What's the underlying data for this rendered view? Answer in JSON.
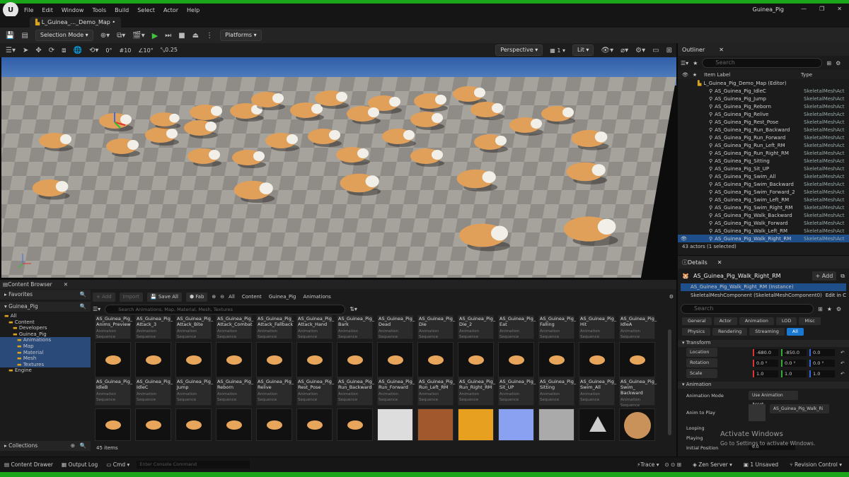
{
  "app": {
    "window_title": "Guinea_Pig",
    "map_tab": "L_Guinea_..._Demo_Map •",
    "menu": [
      "File",
      "Edit",
      "Window",
      "Tools",
      "Build",
      "Select",
      "Actor",
      "Help"
    ]
  },
  "toolbar": {
    "selection_mode": "Selection Mode",
    "platforms": "Platforms"
  },
  "viewport": {
    "perspective": "Perspective",
    "lit": "Lit",
    "snap_rot": "0°",
    "grid": "10",
    "rot_snap": "10°",
    "scale_snap": "0.25",
    "cam_speed": "1",
    "grid_count": "0"
  },
  "outliner": {
    "title": "Outliner",
    "search_placeholder": "Search",
    "col_label": "Item Label",
    "col_type": "Type",
    "root": "L_Guinea_Pig_Demo_Map (Editor)",
    "items": [
      "AS_Guinea_Pig_IdleC",
      "AS_Guinea_Pig_Jump",
      "AS_Guinea_Pig_Reborn",
      "AS_Guinea_Pig_Relive",
      "AS_Guinea_Pig_Rest_Pose",
      "AS_Guinea_Pig_Run_Backward",
      "AS_Guinea_Pig_Run_Forward",
      "AS_Guinea_Pig_Run_Left_RM",
      "AS_Guinea_Pig_Run_Right_RM",
      "AS_Guinea_Pig_Sitting",
      "AS_Guinea_Pig_Sit_UP",
      "AS_Guinea_Pig_Swim_All",
      "AS_Guinea_Pig_Swim_Backward",
      "AS_Guinea_Pig_Swim_Forward_2",
      "AS_Guinea_Pig_Swim_Left_RM",
      "AS_Guinea_Pig_Swim_Right_RM",
      "AS_Guinea_Pig_Walk_Backward",
      "AS_Guinea_Pig_Walk_Forward",
      "AS_Guinea_Pig_Walk_Left_RM",
      "AS_Guinea_Pig_Walk_Right_RM"
    ],
    "item_type": "SkeletalMeshAct",
    "status": "43 actors (1 selected)"
  },
  "details": {
    "title": "Details",
    "actor": "AS_Guinea_Pig_Walk_Right_RM",
    "add": "+ Add",
    "instance": "AS_Guinea_Pig_Walk_Right_RM (Instance)",
    "component": "SkeletalMeshComponent (SkeletalMeshComponent0)",
    "edit_in": "Edit in C",
    "search_placeholder": "Search",
    "tabs": [
      "General",
      "Actor",
      "Animation",
      "LOD",
      "Misc",
      "Physics",
      "Rendering",
      "Streaming",
      "All"
    ],
    "transform": "Transform",
    "location": "Location",
    "rotation": "Rotation",
    "scale": "Scale",
    "loc_vals": [
      "-680.0",
      "-850.0",
      "0.0"
    ],
    "rot_vals": [
      "0.0 °",
      "0.0 °",
      "0.0 °"
    ],
    "scale_vals": [
      "1.0",
      "1.0",
      "1.0"
    ],
    "animation": "Animation",
    "anim_mode_label": "Animation Mode",
    "anim_mode": "Use Animation Asset",
    "anim_to_play": "Anim to Play",
    "anim_asset": "AS_Guinea_Pig_Walk_Ri",
    "looping": "Looping",
    "playing": "Playing",
    "initial_pos": "Initial Position",
    "initial_val": "0.0"
  },
  "content_browser": {
    "title": "Content Browser",
    "favorites": "Favorites",
    "project": "Guinea_Pig",
    "tree": [
      "All",
      "Content",
      "Developers",
      "Guinea_Pig",
      "Animations",
      "Map",
      "Material",
      "Mesh",
      "Textures",
      "Engine"
    ],
    "collections": "Collections",
    "add": "+ Add",
    "import": "Import",
    "save_all": "Save All",
    "fab": "Fab",
    "path": [
      "All",
      "Content",
      "Guinea_Pig",
      "Animations"
    ],
    "search_placeholder": "Search Animations, Map, Material, Mesh, Textures",
    "row1": [
      "AS_Guinea_Pig_ Anims_Preview",
      "AS_Guinea_Pig_ Attack_3",
      "AS_Guinea_Pig_ Attack_Bite",
      "AS_Guinea_Pig_ Attack_Combat",
      "AS_Guinea_Pig_ Attack_Fallback",
      "AS_Guinea_Pig_ Attack_Hand",
      "AS_Guinea_Pig_ Bark",
      "AS_Guinea_Pig_ Dead",
      "AS_Guinea_Pig_ Die",
      "AS_Guinea_Pig_ Die_2",
      "AS_Guinea_Pig_ Eat",
      "AS_Guinea_Pig_ Falling",
      "AS_Guinea_Pig_ Hit",
      "AS_Guinea_Pig_ IdleA"
    ],
    "row2": [
      "AS_Guinea_Pig_ IdleB",
      "AS_Guinea_Pig_ IdleC",
      "AS_Guinea_Pig_ Jump",
      "AS_Guinea_Pig_ Reborn",
      "AS_Guinea_Pig_ Relive",
      "AS_Guinea_Pig_ Rest_Pose",
      "AS_Guinea_Pig_ Run_Backward",
      "AS_Guinea_Pig_ Run_Forward",
      "AS_Guinea_Pig_ Run_Left_RM",
      "AS_Guinea_Pig_ Run_Right_RM",
      "AS_Guinea_Pig_ Sit_UP",
      "AS_Guinea_Pig_ Sitting",
      "AS_Guinea_Pig_ Swim_All",
      "AS_Guinea_Pig_ Swim_ Backward"
    ],
    "asset_type": "Animation Sequence",
    "count": "45 items"
  },
  "statusbar": {
    "drawer": "Content Drawer",
    "output": "Output Log",
    "cmd": "Cmd",
    "console_placeholder": "Enter Console Command",
    "trace": "Trace",
    "zen": "Zen Server",
    "unsaved": "1 Unsaved",
    "revision": "Revision Control"
  },
  "watermark": {
    "line1": "Activate Windows",
    "line2": "Go to Settings to activate Windows."
  }
}
